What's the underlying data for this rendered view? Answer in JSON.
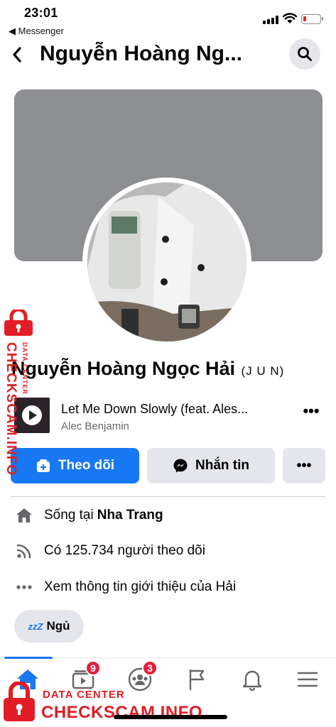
{
  "status_bar": {
    "time": "23:01",
    "back_app_label": "◀ Messenger"
  },
  "header": {
    "title": "Nguyễn Hoàng Ng...",
    "back_icon": "chevron-left-icon",
    "search_icon": "search-icon"
  },
  "profile": {
    "name": "Nguyễn Hoàng Ngọc Hải",
    "nickname": "(J U N)"
  },
  "music": {
    "song_title": "Let Me Down Slowly (feat. Ales...",
    "artist": "Alec Benjamin",
    "more_label": "•••"
  },
  "actions": {
    "follow_label": "Theo dõi",
    "message_label": "Nhắn tin",
    "more_label": "•••"
  },
  "info": {
    "lives_prefix": "Sống tại",
    "lives_city": "Nha Trang",
    "followers": "Có 125.734 người theo dõi",
    "about": "Xem thông tin giới thiệu của Hải"
  },
  "status_pill": {
    "emoji": "zzZ",
    "label": "Ngủ"
  },
  "bottom_nav": {
    "items": [
      {
        "icon": "home-icon",
        "active": true
      },
      {
        "icon": "watch-icon",
        "badge": "9"
      },
      {
        "icon": "groups-icon",
        "badge": "3"
      },
      {
        "icon": "flag-icon"
      },
      {
        "icon": "bell-icon"
      },
      {
        "icon": "menu-icon"
      }
    ]
  },
  "watermark": {
    "small": "DATA CENTER",
    "big": "CHECKSCAM.INFO"
  },
  "colors": {
    "accent": "#1877f2",
    "watermark": "#e11d25",
    "badge": "#e41e3f"
  }
}
